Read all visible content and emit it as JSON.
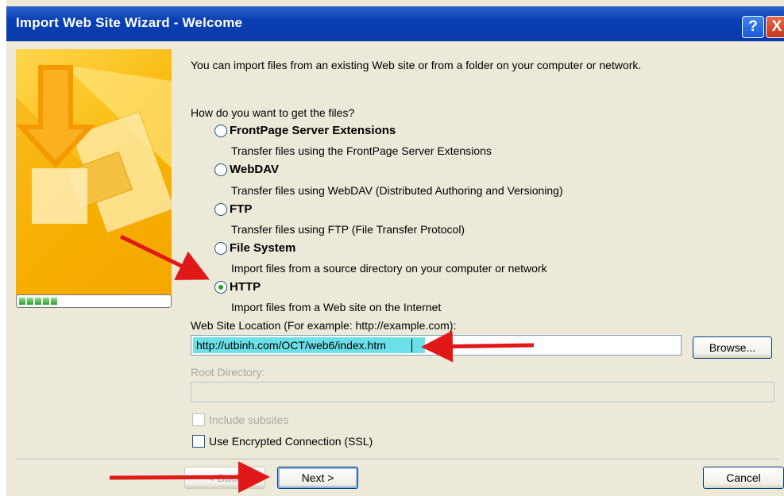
{
  "window": {
    "title": "Import Web Site Wizard - Welcome",
    "help_label": "?",
    "close_label": "X"
  },
  "intro": "You can import files from an existing Web site or from a folder on your computer or network.",
  "question": "How do you want to get the files?",
  "options": [
    {
      "label": "FrontPage Server Extensions",
      "description": "Transfer files using the FrontPage Server Extensions",
      "selected": false
    },
    {
      "label": "WebDAV",
      "description": "Transfer files using WebDAV (Distributed Authoring and Versioning)",
      "selected": false
    },
    {
      "label": "FTP",
      "description": "Transfer files using FTP (File Transfer Protocol)",
      "selected": false
    },
    {
      "label": "File System",
      "description": "Import files from a source directory on your computer or network",
      "selected": false
    },
    {
      "label": "HTTP",
      "description": "Import files from a Web site on the Internet",
      "selected": true
    }
  ],
  "location": {
    "label": "Web Site Location (For example: http://example.com):",
    "value": "http://utbinh.com/OCT/web6/index.htm",
    "browse_label": "Browse..."
  },
  "root": {
    "label": "Root Directory:",
    "value": ""
  },
  "checkboxes": {
    "subsites_label": "Include subsites",
    "ssl_label": "Use Encrypted Connection (SSL)"
  },
  "buttons": {
    "back_label": "< Back",
    "next_label": "Next >",
    "cancel_label": "Cancel"
  },
  "progress": {
    "steps_done": 5,
    "accent": "#21a121"
  },
  "colors": {
    "titlebar": "#0a3fb5",
    "dialog": "#ece9d8",
    "annotation_arrow": "#e01818",
    "highlight": "#6ce0e8"
  }
}
